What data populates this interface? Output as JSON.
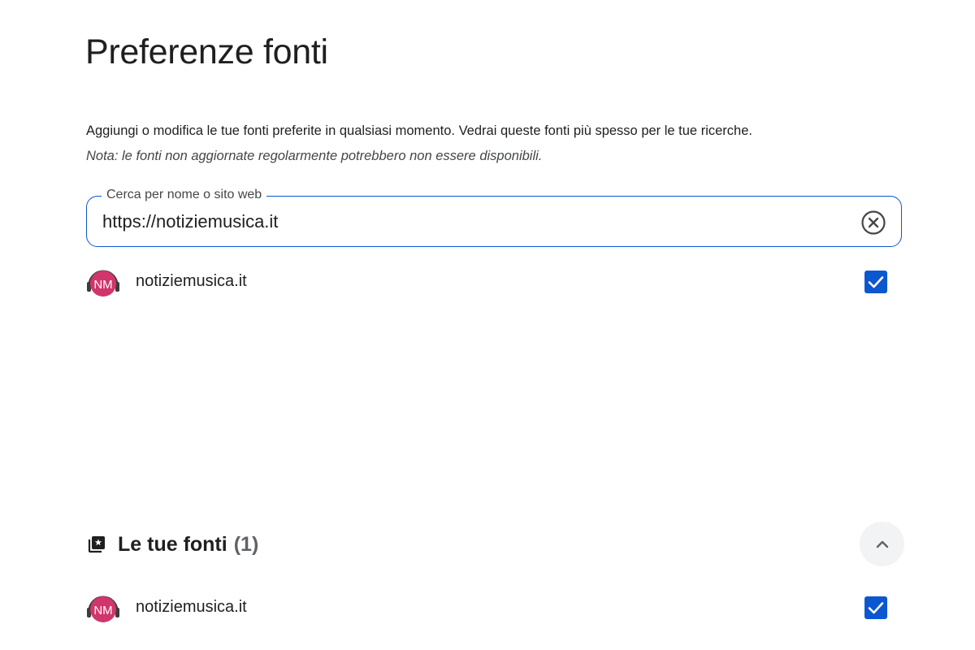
{
  "page": {
    "title": "Preferenze fonti",
    "description": "Aggiungi o modifica le tue fonti preferite in qualsiasi momento. Vedrai queste fonti più spesso per le tue ricerche.",
    "note": "Nota: le fonti non aggiornate regolarmente potrebbero non essere disponibili."
  },
  "search": {
    "label": "Cerca per nome o sito web",
    "value": "https://notiziemusica.it",
    "clear_icon": "close-circle-icon"
  },
  "search_results": [
    {
      "logo_text": "NM",
      "name": "notiziemusica.it",
      "checked": true
    }
  ],
  "your_sources": {
    "title": "Le tue fonti",
    "count": "(1)",
    "icon": "star-library-icon",
    "collapse_icon": "chevron-up-icon",
    "items": [
      {
        "logo_text": "NM",
        "name": "notiziemusica.it",
        "checked": true
      }
    ]
  },
  "colors": {
    "accent": "#0b57d0",
    "logo_pink": "#d1356b",
    "text": "#1f1f1f"
  }
}
